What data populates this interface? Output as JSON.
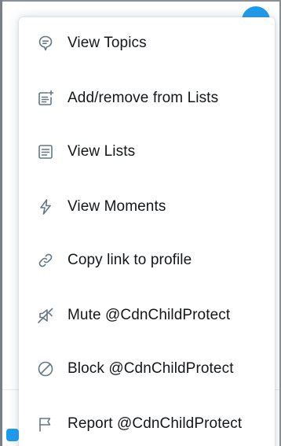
{
  "colors": {
    "text": "#14171a",
    "icon": "#657786",
    "accent": "#1d9bf0"
  },
  "menu": {
    "items": [
      {
        "label": "View Topics",
        "icon": "topic-bubble-icon"
      },
      {
        "label": "Add/remove from Lists",
        "icon": "list-add-icon"
      },
      {
        "label": "View Lists",
        "icon": "list-icon"
      },
      {
        "label": "View Moments",
        "icon": "lightning-icon"
      },
      {
        "label": "Copy link to profile",
        "icon": "link-icon"
      },
      {
        "label": "Mute @CdnChildProtect",
        "icon": "mute-speaker-icon"
      },
      {
        "label": "Block @CdnChildProtect",
        "icon": "block-icon"
      },
      {
        "label": "Report @CdnChildProtect",
        "icon": "flag-icon"
      }
    ]
  }
}
